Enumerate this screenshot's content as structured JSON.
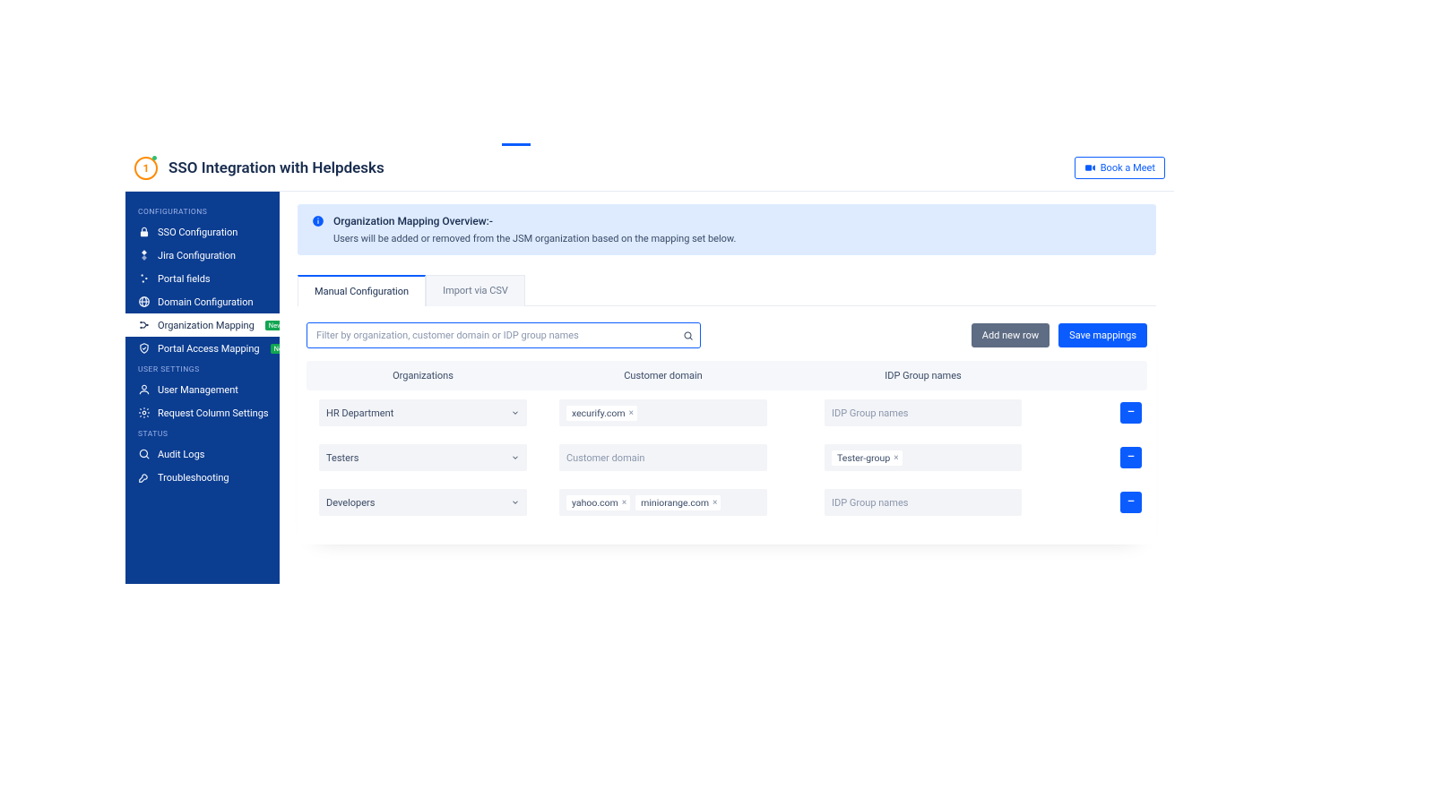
{
  "header": {
    "title": "SSO Integration with Helpdesks",
    "book_meet_label": "Book a Meet"
  },
  "sidebar": {
    "sections": [
      {
        "label": "CONFIGURATIONS",
        "items": [
          {
            "icon": "lock-icon",
            "label": "SSO Configuration"
          },
          {
            "icon": "jira-icon",
            "label": "Jira Configuration"
          },
          {
            "icon": "sliders-icon",
            "label": "Portal fields"
          },
          {
            "icon": "globe-icon",
            "label": "Domain Configuration"
          },
          {
            "icon": "mapping-icon",
            "label": "Organization Mapping",
            "active": true,
            "badge": "New"
          },
          {
            "icon": "shield-icon",
            "label": "Portal Access Mapping",
            "badge": "New"
          }
        ]
      },
      {
        "label": "USER SETTINGS",
        "items": [
          {
            "icon": "user-icon",
            "label": "User Management"
          },
          {
            "icon": "gear-icon",
            "label": "Request Column Settings"
          }
        ]
      },
      {
        "label": "STATUS",
        "items": [
          {
            "icon": "search-icon",
            "label": "Audit Logs"
          },
          {
            "icon": "wrench-icon",
            "label": "Troubleshooting"
          }
        ]
      }
    ]
  },
  "banner": {
    "title": "Organization Mapping Overview:-",
    "subtitle": "Users will be added or removed from the JSM organization based on the mapping set below."
  },
  "tabs": {
    "items": [
      "Manual Configuration",
      "Import via CSV"
    ],
    "active_index": 0
  },
  "toolbar": {
    "search_placeholder": "Filter by organization, customer domain or IDP group names",
    "add_row_label": "Add new row",
    "save_label": "Save mappings"
  },
  "table": {
    "columns": [
      "Organizations",
      "Customer domain",
      "IDP Group names"
    ],
    "domain_placeholder": "Customer domain",
    "idp_placeholder": "IDP Group names",
    "rows": [
      {
        "organization": "HR Department",
        "domains": [
          "xecurify.com"
        ],
        "idp_groups": []
      },
      {
        "organization": "Testers",
        "domains": [],
        "idp_groups": [
          "Tester-group"
        ]
      },
      {
        "organization": "Developers",
        "domains": [
          "yahoo.com",
          "miniorange.com"
        ],
        "idp_groups": []
      }
    ]
  }
}
